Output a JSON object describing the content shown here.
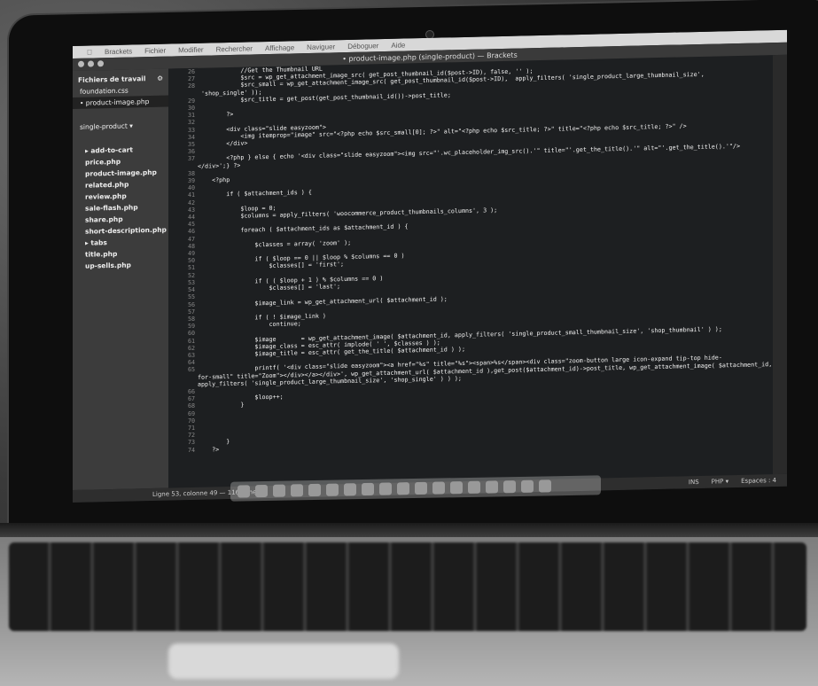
{
  "menubar": {
    "items": [
      "Brackets",
      "Fichier",
      "Modifier",
      "Rechercher",
      "Affichage",
      "Naviguer",
      "Déboguer",
      "Aide"
    ]
  },
  "window": {
    "title": "• product-image.php (single-product) — Brackets"
  },
  "sidebar": {
    "header": "Fichiers de travail",
    "working_files": [
      "foundation.css",
      "• product-image.php"
    ],
    "project": "single-product ▾",
    "tree": [
      "▸ add-to-cart",
      "price.php",
      "product-image.php",
      "related.php",
      "review.php",
      "sale-flash.php",
      "share.php",
      "short-description.php",
      "▸ tabs",
      "title.php",
      "up-sells.php"
    ]
  },
  "gutter": {
    "lines": "26\n27\n28\n\n29\n30\n31\n32\n33\n34\n35\n36\n37\n\n38\n39\n40\n41\n42\n43\n44\n45\n46\n47\n48\n49\n50\n51\n52\n53\n54\n55\n56\n57\n58\n59\n60\n61\n62\n63\n64\n65\n\n\n66\n67\n68\n69\n70\n71\n72\n73\n74"
  },
  "code": {
    "text": "            //Get the Thumbnail URL\n            $src = wp_get_attachment_image_src( get_post_thumbnail_id($post->ID), false, '' );\n            $src_small = wp_get_attachment_image_src( get_post_thumbnail_id($post->ID),  apply_filters( 'single_product_large_thumbnail_size',\n 'shop_single' ));\n            $src_title = get_post(get_post_thumbnail_id())->post_title;\n\n        ?>\n\n        <div class=\"slide easyzoom\">\n            <img itemprop=\"image\" src=\"<?php echo $src_small[0]; ?>\" alt=\"<?php echo $src_title; ?>\" title=\"<?php echo $src_title; ?>\" />\n        </div>\n\n        <?php } else { echo '<div class=\"slide easyzoom\"><img src=\"'.wc_placeholder_img_src().'\" title=\"'.get_the_title().'\" alt=\"'.get_the_title().'\"/>\n</div>';} ?>\n\n    <?php\n\n        if ( $attachment_ids ) {\n\n            $loop = 0;\n            $columns = apply_filters( 'woocommerce_product_thumbnails_columns', 3 );\n\n            foreach ( $attachment_ids as $attachment_id ) {\n\n                $classes = array( 'zoom' );\n\n                if ( $loop == 0 || $loop % $columns == 0 )\n                    $classes[] = 'first';\n\n                if ( ( $loop + 1 ) % $columns == 0 )\n                    $classes[] = 'last';\n\n                $image_link = wp_get_attachment_url( $attachment_id );\n\n                if ( ! $image_link )\n                    continue;\n\n                $image       = wp_get_attachment_image( $attachment_id, apply_filters( 'single_product_small_thumbnail_size', 'shop_thumbnail' ) );\n                $image_class = esc_attr( implode( ' ', $classes ) );\n                $image_title = esc_attr( get_the_title( $attachment_id ) );\n\n                printf( '<div class=\"slide easyzoom\"><a href=\"%s\" title=\"%s\"><span>%s</span><div class=\"zoom-button large icon-expand tip-top hide-\nfor-small\" title=\"Zoom\"></div></a></div>', wp_get_attachment_url( $attachment_id ),get_post($attachment_id)->post_title, wp_get_attachment_image( $attachment_id,\napply_filters( 'single_product_large_thumbnail_size', 'shop_single' ) ) );\n\n                $loop++;\n            }\n\n\n\n\n        }\n    ?>"
  },
  "statusbar": {
    "position": "Ligne 53, colonne 49 — 116 lignes",
    "ins": "INS",
    "lang": "PHP ▾",
    "spaces": "Espaces : 4"
  }
}
